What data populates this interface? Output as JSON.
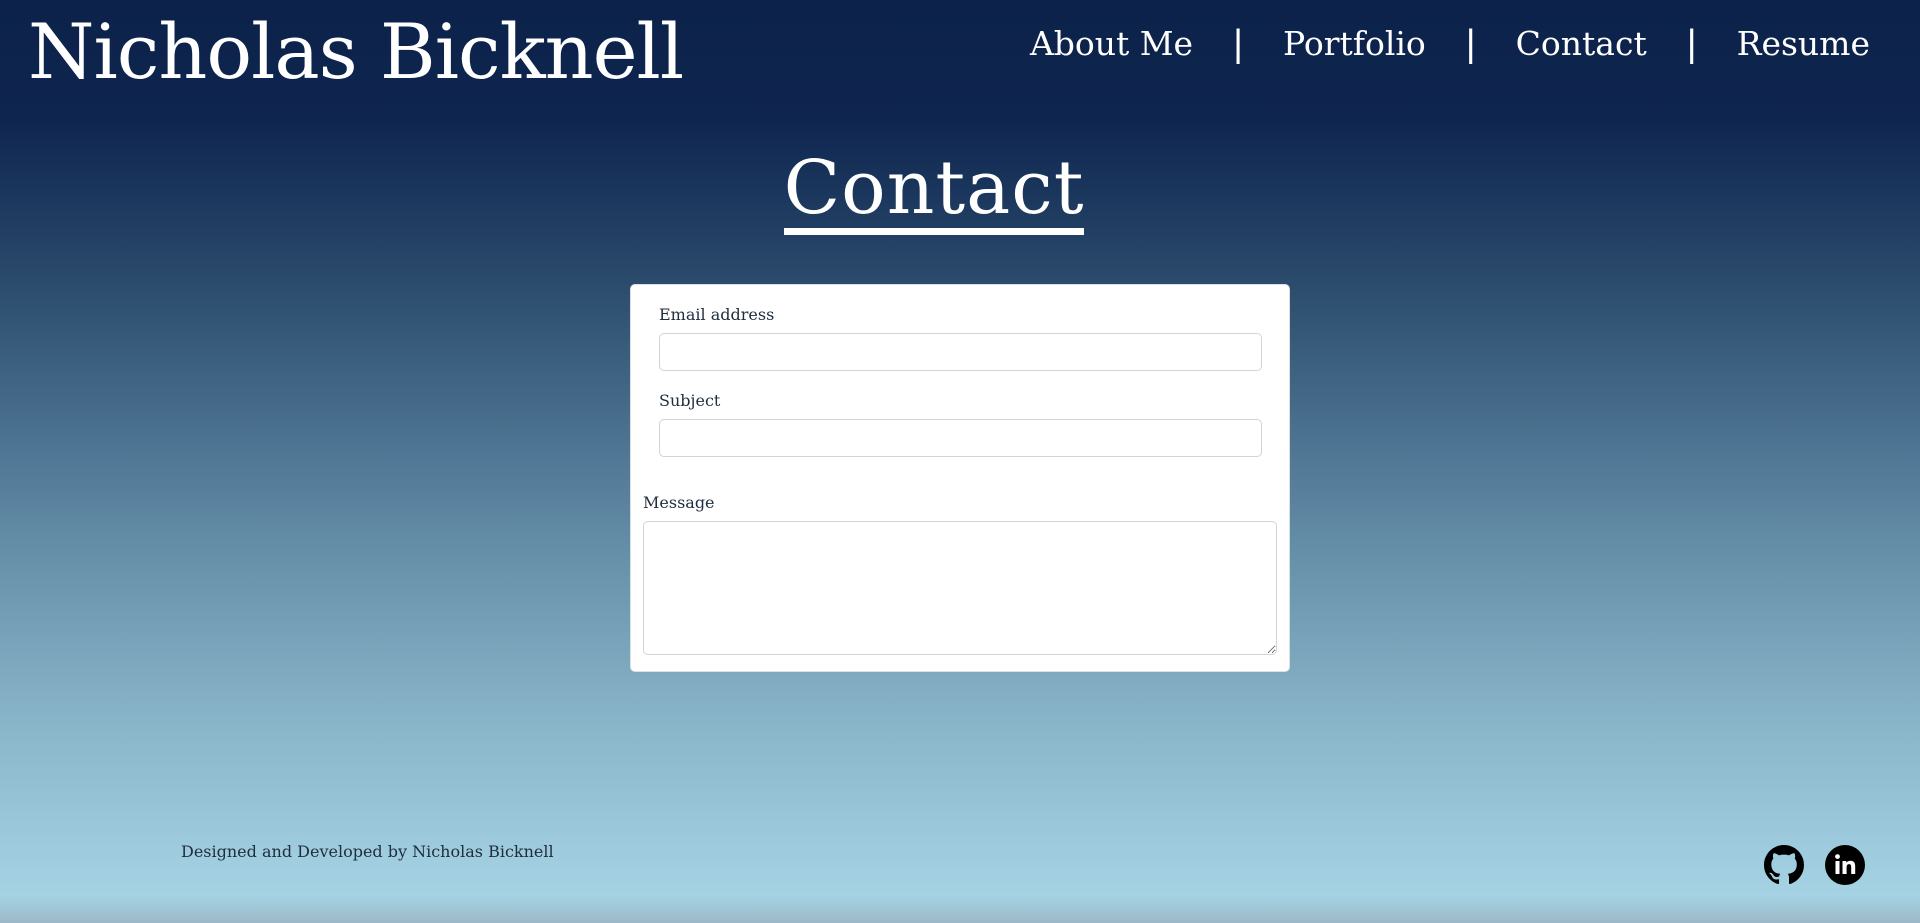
{
  "header": {
    "site_title": "Nicholas Bicknell",
    "nav": {
      "about": "About Me",
      "portfolio": "Portfolio",
      "contact": "Contact",
      "resume": "Resume",
      "separator": "|"
    }
  },
  "main": {
    "heading": "Contact",
    "form": {
      "email_label": "Email address",
      "email_value": "",
      "subject_label": "Subject",
      "subject_value": "",
      "message_label": "Message",
      "message_value": ""
    }
  },
  "footer": {
    "credit": "Designed and Developed by Nicholas Bicknell",
    "social": [
      {
        "icon": "github-icon",
        "label": "GitHub"
      },
      {
        "icon": "linkedin-icon",
        "label": "LinkedIn"
      }
    ]
  },
  "colors": {
    "navy": "#0c2249",
    "sky": "#a5d3e4",
    "text_dark": "#1f2d3d",
    "white": "#ffffff"
  }
}
